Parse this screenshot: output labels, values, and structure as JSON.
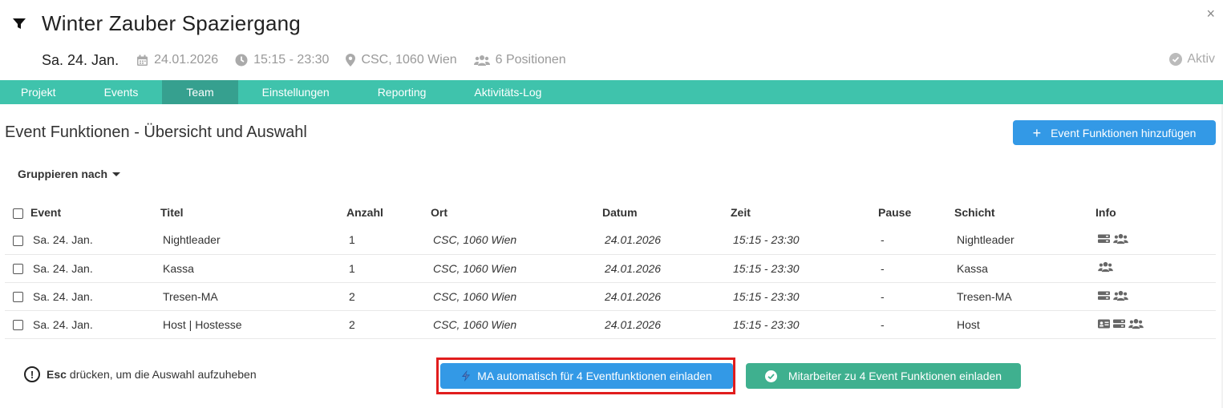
{
  "header": {
    "title": "Winter Zauber Spaziergang",
    "day": "Sa. 24. Jan.",
    "date": "24.01.2026",
    "time": "15:15 - 23:30",
    "location": "CSC, 1060 Wien",
    "positions": "6 Positionen",
    "status": "Aktiv",
    "close": "×"
  },
  "tabs": [
    {
      "label": "Projekt"
    },
    {
      "label": "Events"
    },
    {
      "label": "Team",
      "active": true
    },
    {
      "label": "Einstellungen"
    },
    {
      "label": "Reporting"
    },
    {
      "label": "Aktivitäts-Log"
    }
  ],
  "section": {
    "title": "Event Funktionen - Übersicht und Auswahl",
    "add_button": "Event Funktionen hinzufügen",
    "group_by": "Gruppieren nach"
  },
  "table": {
    "columns": [
      "Event",
      "Titel",
      "Anzahl",
      "Ort",
      "Datum",
      "Zeit",
      "Pause",
      "Schicht",
      "Info"
    ],
    "rows": [
      {
        "event": "Sa. 24. Jan.",
        "titel": "Nightleader",
        "anzahl": "1",
        "ort": "CSC, 1060 Wien",
        "datum": "24.01.2026",
        "zeit": "15:15 - 23:30",
        "pause": "-",
        "schicht": "Nightleader",
        "info": [
          "list-icon",
          "users-icon"
        ]
      },
      {
        "event": "Sa. 24. Jan.",
        "titel": "Kassa",
        "anzahl": "1",
        "ort": "CSC, 1060 Wien",
        "datum": "24.01.2026",
        "zeit": "15:15 - 23:30",
        "pause": "-",
        "schicht": "Kassa",
        "info": [
          "users-icon"
        ]
      },
      {
        "event": "Sa. 24. Jan.",
        "titel": "Tresen-MA",
        "anzahl": "2",
        "ort": "CSC, 1060 Wien",
        "datum": "24.01.2026",
        "zeit": "15:15 - 23:30",
        "pause": "-",
        "schicht": "Tresen-MA",
        "info": [
          "list-icon",
          "users-icon"
        ]
      },
      {
        "event": "Sa. 24. Jan.",
        "titel": "Host | Hostesse",
        "anzahl": "2",
        "ort": "CSC, 1060 Wien",
        "datum": "24.01.2026",
        "zeit": "15:15 - 23:30",
        "pause": "-",
        "schicht": "Host",
        "info": [
          "id-card-icon",
          "list-icon",
          "users-icon"
        ]
      }
    ]
  },
  "footer": {
    "hint_key": "Esc",
    "hint_text": "drücken, um die Auswahl aufzuheben",
    "hint_icon": "!",
    "auto_invite_button": "MA automatisch für 4 Eventfunktionen einladen",
    "invite_button": "Mitarbeiter zu 4 Event Funktionen einladen"
  },
  "colors": {
    "accent_teal": "#3fc3ac",
    "tab_active": "#36a08f",
    "primary_blue": "#3399e6",
    "green_button": "#3fb08f",
    "highlight_red": "#e11d1d"
  }
}
